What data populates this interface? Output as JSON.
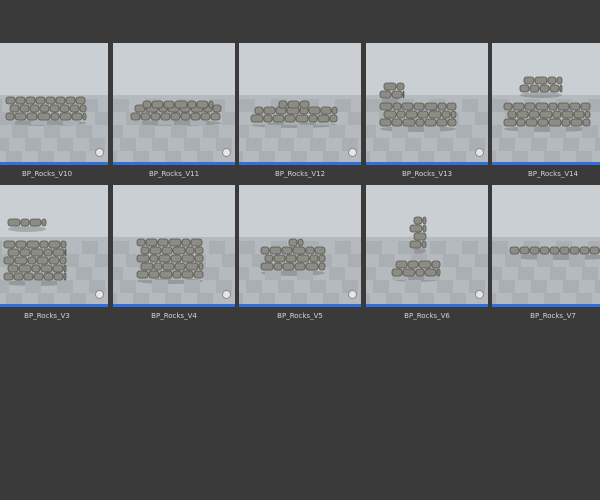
{
  "assets": [
    {
      "name": "BP_Rocks_V10",
      "icon": "rock-wall-thumbnail-icon"
    },
    {
      "name": "BP_Rocks_V11",
      "icon": "rock-wall-thumbnail-icon"
    },
    {
      "name": "BP_Rocks_V12",
      "icon": "rock-wall-thumbnail-icon"
    },
    {
      "name": "BP_Rocks_V13",
      "icon": "rock-wall-thumbnail-icon"
    },
    {
      "name": "BP_Rocks_V14",
      "icon": "rock-wall-thumbnail-icon"
    },
    {
      "name": "BP_Rocks_V3",
      "icon": "rock-wall-thumbnail-icon"
    },
    {
      "name": "BP_Rocks_V4",
      "icon": "rock-wall-thumbnail-icon"
    },
    {
      "name": "BP_Rocks_V5",
      "icon": "rock-wall-thumbnail-icon"
    },
    {
      "name": "BP_Rocks_V6",
      "icon": "rock-wall-thumbnail-icon"
    },
    {
      "name": "BP_Rocks_V7",
      "icon": "rock-wall-thumbnail-icon"
    }
  ],
  "colors": {
    "background": "#3a3a3a",
    "thumbnail_sky": "#c9cfd3",
    "asset_type_bar": "#2f6fe0",
    "rock": "#8c8c84",
    "label": "#d2d2d2"
  }
}
